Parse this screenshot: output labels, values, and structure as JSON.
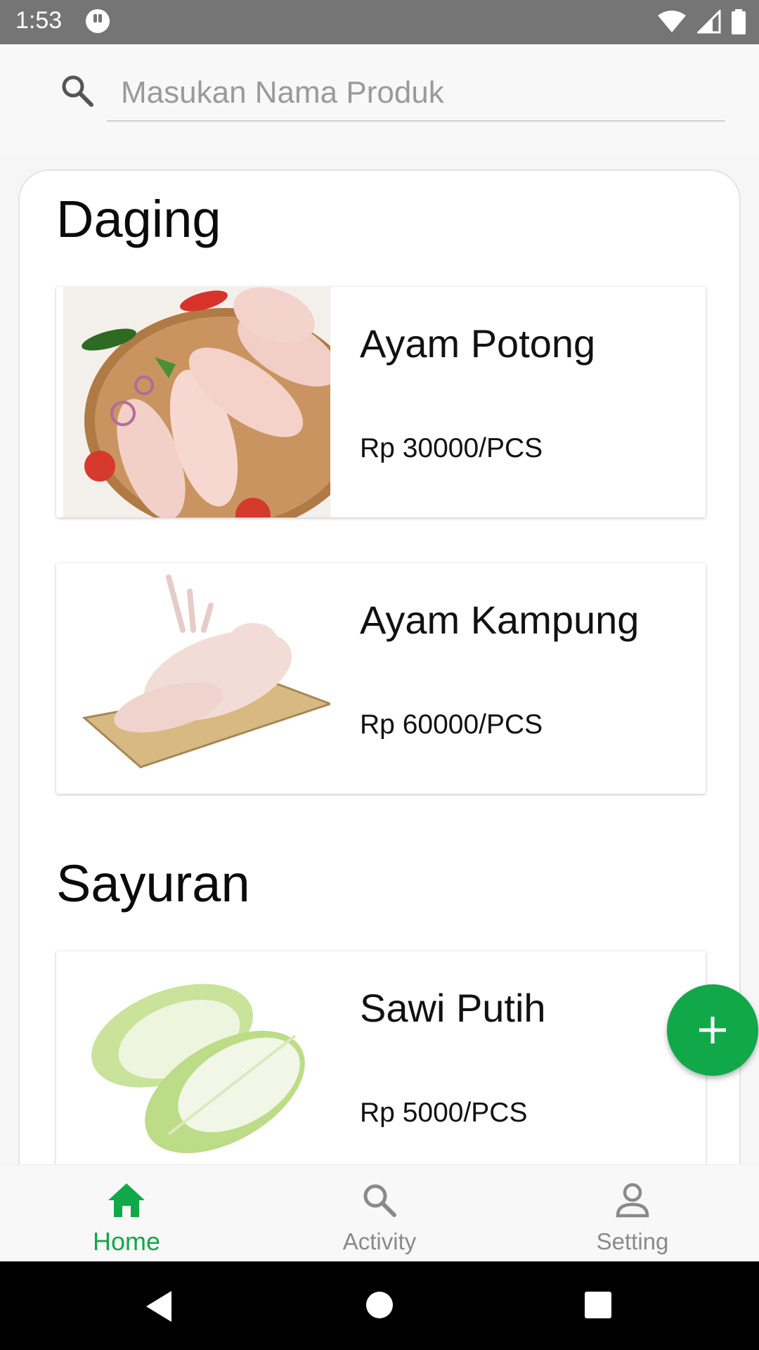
{
  "status_bar": {
    "time": "1:53"
  },
  "search": {
    "placeholder": "Masukan Nama Produk"
  },
  "sections": [
    {
      "title": "Daging",
      "products": [
        {
          "name": "Ayam Potong",
          "price": "Rp 30000/PCS",
          "image": "chicken-drumsticks"
        },
        {
          "name": "Ayam Kampung",
          "price": "Rp 60000/PCS",
          "image": "whole-chicken"
        }
      ]
    },
    {
      "title": "Sayuran",
      "products": [
        {
          "name": "Sawi Putih",
          "price": "Rp 5000/PCS",
          "image": "napa-cabbage"
        }
      ]
    }
  ],
  "fab": {
    "icon": "plus-icon",
    "color": "#11a84a"
  },
  "bottom_nav": {
    "items": [
      {
        "label": "Home",
        "icon": "home-icon",
        "active": true
      },
      {
        "label": "Activity",
        "icon": "search-icon",
        "active": false
      },
      {
        "label": "Setting",
        "icon": "person-icon",
        "active": false
      }
    ]
  },
  "colors": {
    "accent": "#11a84a",
    "status_bar": "#757575"
  }
}
